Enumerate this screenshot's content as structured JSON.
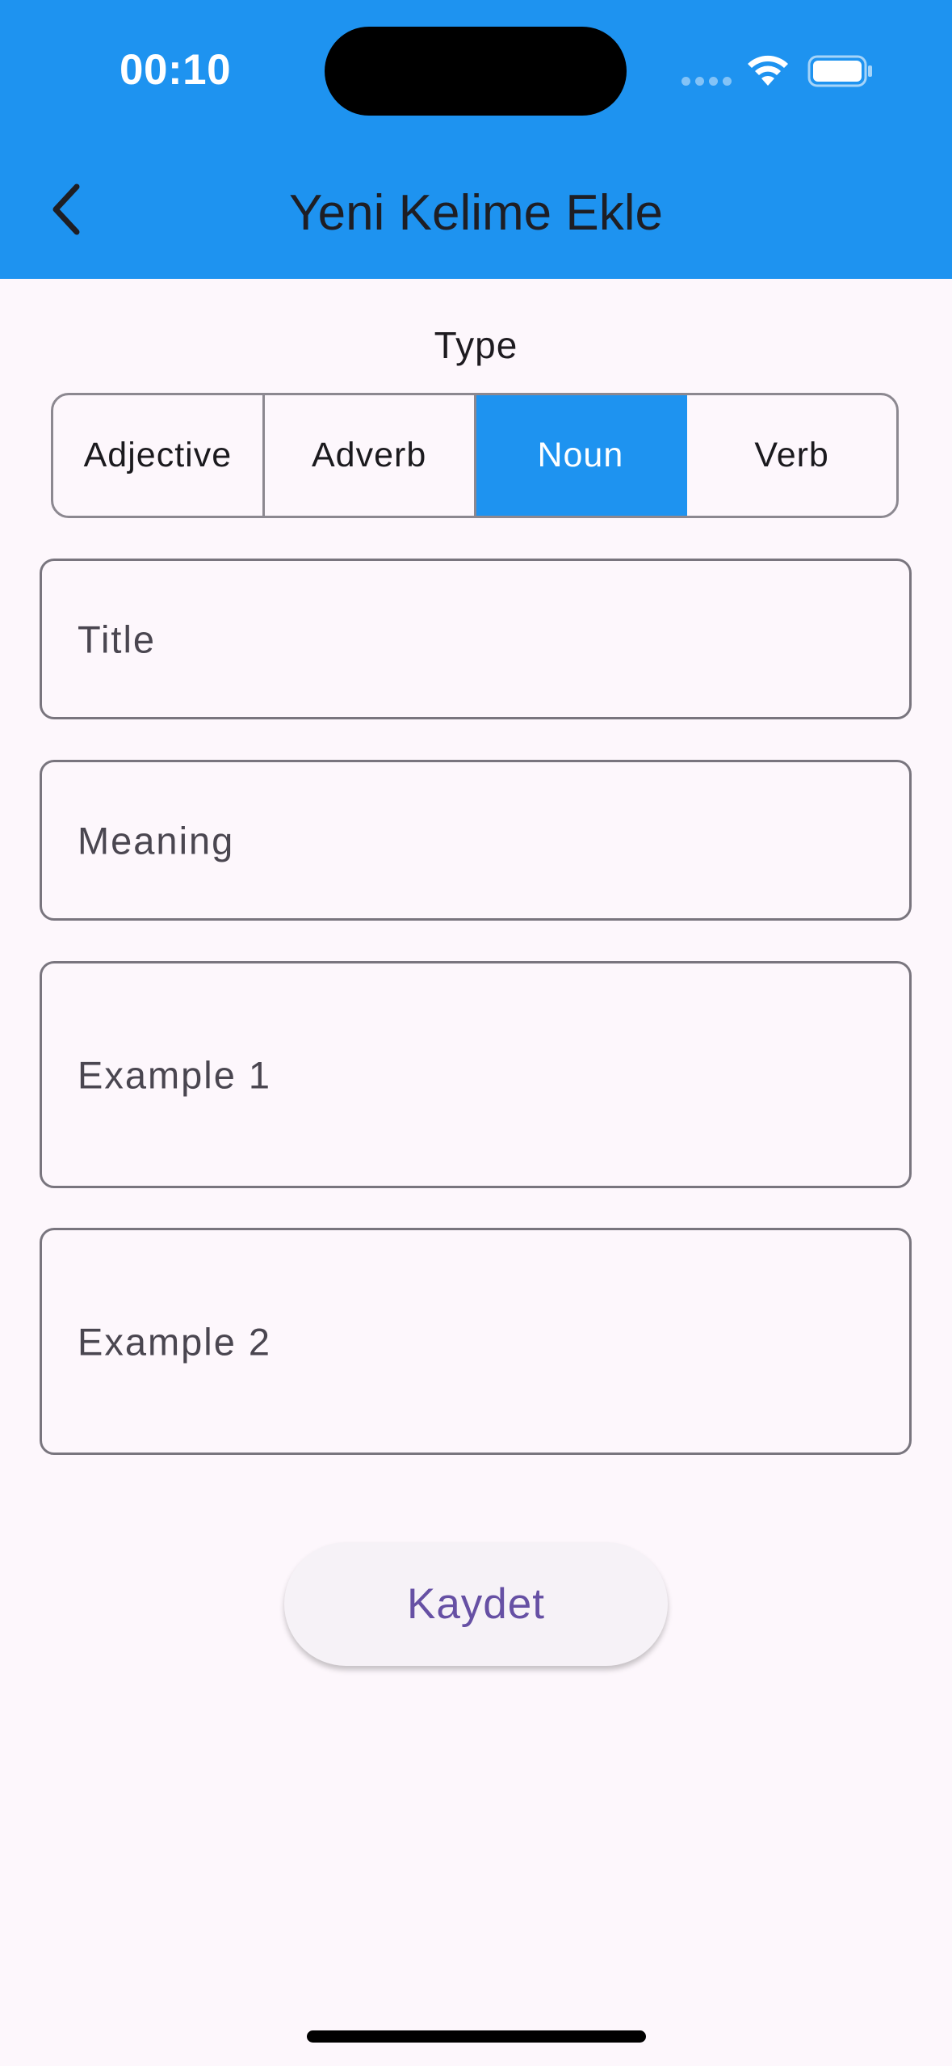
{
  "status_bar": {
    "time": "00:10",
    "icons": [
      "signal-icon",
      "wifi-icon",
      "battery-icon"
    ]
  },
  "header": {
    "title": "Yeni Kelime Ekle",
    "back_icon": "chevron-left-icon",
    "background": "#1E93F0"
  },
  "type_selector": {
    "label": "Type",
    "options": [
      "Adjective",
      "Adverb",
      "Noun",
      "Verb"
    ],
    "selected": "Noun",
    "accent": "#1E93F0"
  },
  "form": {
    "title_placeholder": "Title",
    "meaning_placeholder": "Meaning",
    "example1_placeholder": "Example 1",
    "example2_placeholder": "Example 2"
  },
  "actions": {
    "save_label": "Kaydet",
    "save_color": "#6650A4"
  }
}
